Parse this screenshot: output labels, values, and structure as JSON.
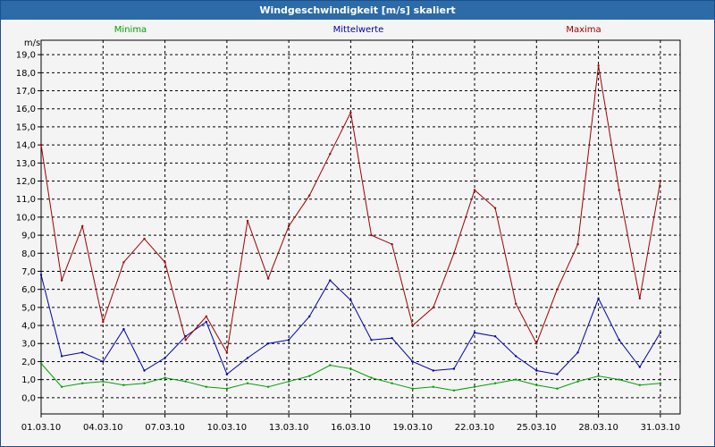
{
  "window": {
    "title": "Windgeschwindigkeit [m/s] skaliert"
  },
  "chart_data": {
    "type": "line",
    "title": "Windgeschwindigkeit [m/s] skaliert",
    "ylabel": "m/s",
    "ylim": [
      -0.9,
      19.8
    ],
    "grid": true,
    "x_range": [
      "01.03.10",
      "31.03.10 23:00"
    ],
    "x_ticks": [
      "01.03.10",
      "04.03.10",
      "07.03.10",
      "10.03.10",
      "13.03.10",
      "16.03.10",
      "19.03.10",
      "22.03.10",
      "25.03.10",
      "28.03.10",
      "31.03.10"
    ],
    "y_ticks": [
      "0,0",
      "1,0",
      "2,0",
      "3,0",
      "4,0",
      "5,0",
      "6,0",
      "7,0",
      "8,0",
      "9,0",
      "10,0",
      "11,0",
      "12,0",
      "13,0",
      "14,0",
      "15,0",
      "16,0",
      "17,0",
      "18,0",
      "19,0"
    ],
    "x": [
      "01.03.10",
      "02.03.10",
      "03.03.10",
      "04.03.10",
      "05.03.10",
      "06.03.10",
      "07.03.10",
      "08.03.10",
      "09.03.10",
      "10.03.10",
      "11.03.10",
      "12.03.10",
      "13.03.10",
      "14.03.10",
      "15.03.10",
      "16.03.10",
      "17.03.10",
      "18.03.10",
      "19.03.10",
      "20.03.10",
      "21.03.10",
      "22.03.10",
      "23.03.10",
      "24.03.10",
      "25.03.10",
      "26.03.10",
      "27.03.10",
      "28.03.10",
      "29.03.10",
      "30.03.10",
      "31.03.10"
    ],
    "series": [
      {
        "name": "Minima",
        "color": "#00a000",
        "values": [
          1.9,
          0.6,
          0.8,
          0.9,
          0.7,
          0.8,
          1.1,
          0.9,
          0.6,
          0.5,
          0.8,
          0.6,
          0.9,
          1.2,
          1.8,
          1.6,
          1.1,
          0.8,
          0.5,
          0.6,
          0.4,
          0.6,
          0.8,
          1.0,
          0.7,
          0.5,
          0.9,
          1.2,
          1.0,
          0.7,
          0.8
        ]
      },
      {
        "name": "Mittelwerte",
        "color": "#0000b0",
        "values": [
          6.8,
          2.3,
          2.5,
          2.0,
          3.8,
          1.5,
          2.2,
          3.4,
          4.2,
          1.3,
          2.2,
          3.0,
          3.2,
          4.5,
          6.5,
          5.4,
          3.2,
          3.3,
          2.0,
          1.5,
          1.6,
          3.6,
          3.4,
          2.3,
          1.5,
          1.3,
          2.5,
          5.5,
          3.2,
          1.7,
          3.6
        ]
      },
      {
        "name": "Maxima",
        "color": "#a00000",
        "values": [
          14.0,
          6.5,
          9.5,
          4.2,
          7.5,
          8.8,
          7.5,
          3.2,
          4.5,
          2.5,
          9.8,
          6.6,
          9.5,
          11.2,
          13.5,
          15.8,
          9.0,
          8.5,
          4.0,
          5.0,
          8.0,
          11.5,
          10.5,
          5.2,
          3.0,
          6.0,
          8.5,
          18.4,
          11.5,
          5.5,
          12.0
        ]
      }
    ]
  }
}
